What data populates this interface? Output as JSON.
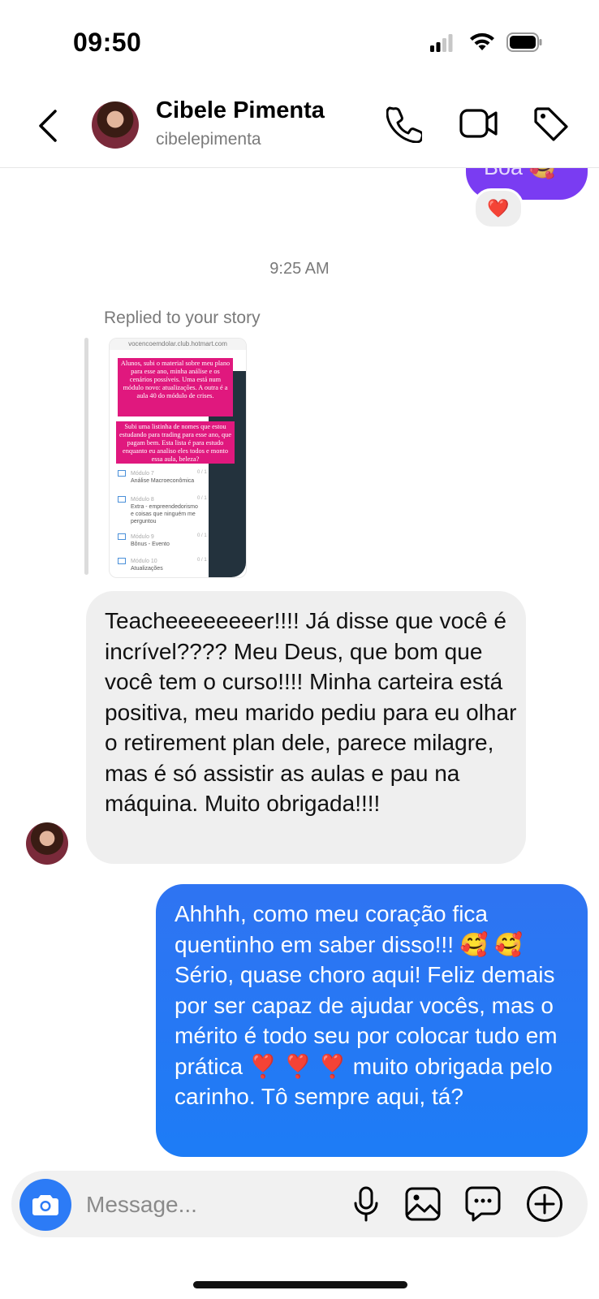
{
  "status_bar": {
    "time": "09:50"
  },
  "header": {
    "contact_name": "Cibele Pimenta",
    "username": "cibelepimenta",
    "icons": [
      "back-chevron-icon",
      "phone-icon",
      "video-camera-icon",
      "tag-icon"
    ]
  },
  "previous_message": {
    "text": "Boa 🥰",
    "reaction": "❤️"
  },
  "timestamp": "9:25 AM",
  "story_reply": {
    "label": "Replied to your story",
    "story": {
      "url": "vocencoemdolar.club.hotmart.com",
      "overlay_1": "Alunos, subi o material sobre meu plano para esse ano, minha análise e os cenários possíveis. Uma está num módulo novo: atualizações. A outra é a aula 40 do módulo de crises.",
      "overlay_2": "Subi uma listinha de nomes que estou estudando para trading para esse ano, que pagam bem. Esta lista é para estudo enquanto eu analiso eles todos e monto essa aula, beleza?",
      "modules": [
        {
          "number": "Módulo 7",
          "title": "Análise Macroeconômica",
          "count": "0 / 1"
        },
        {
          "number": "Módulo 8",
          "title": "Extra - empreendedorismo e coisas que ninguém me perguntou",
          "count": "0 / 1"
        },
        {
          "number": "Módulo 9",
          "title": "Bônus - Evento",
          "count": "0 / 1"
        },
        {
          "number": "Módulo 10",
          "title": "Atualizações",
          "count": "0 / 1"
        }
      ]
    }
  },
  "incoming_message": {
    "text": "Teacheeeeeeeer!!!! Já disse que você é incrível???? Meu Deus, que bom que você tem o curso!!!! Minha carteira está positiva, meu marido pediu para eu olhar o retirement plan dele, parece milagre, mas é só assistir as aulas e pau na máquina. Muito obrigada!!!!"
  },
  "outgoing_message": {
    "text": "Ahhhh, como meu coração fica quentinho em saber disso!!! 🥰 🥰 Sério, quase choro aqui! Feliz demais por ser capaz de ajudar vocês, mas o mérito é todo seu por colocar tudo em prática ❣️ ❣️ ❣️ muito obrigada pelo carinho. Tô sempre aqui, tá?"
  },
  "composer": {
    "placeholder": "Message...",
    "value": "",
    "icons": [
      "camera-icon",
      "microphone-icon",
      "gallery-icon",
      "sticker-chat-icon",
      "plus-circle-icon"
    ]
  },
  "colors": {
    "outgoing_bubble": "#2f74f2",
    "previous_bubble": "#7a3cf2",
    "incoming_bubble": "#efefef",
    "camera_button": "#2c7bf6",
    "story_overlay": "#e0187e"
  }
}
